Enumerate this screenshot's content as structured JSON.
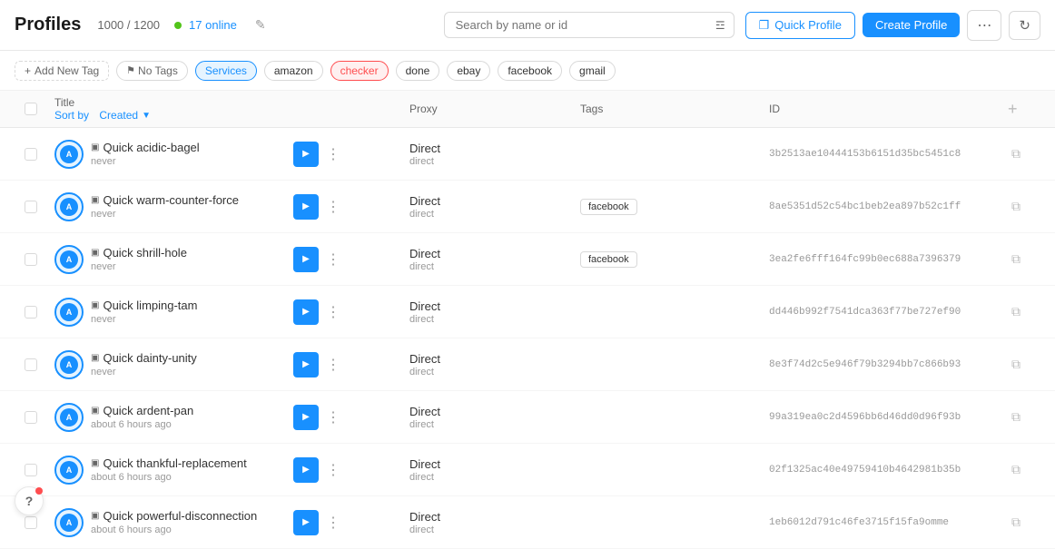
{
  "header": {
    "title": "Profiles",
    "count": "1000 / 1200",
    "online_count": "17 online",
    "search_placeholder": "Search by name or id",
    "quick_profile_label": "Quick Profile",
    "create_profile_label": "Create Profile"
  },
  "tags": [
    {
      "id": "no-tags",
      "label": "No Tags",
      "style": "notag",
      "has_icon": true
    },
    {
      "id": "services",
      "label": "Services",
      "style": "services",
      "has_icon": false
    },
    {
      "id": "amazon",
      "label": "amazon",
      "style": "default",
      "has_icon": false
    },
    {
      "id": "checker",
      "label": "checker",
      "style": "checker",
      "has_icon": false
    },
    {
      "id": "done",
      "label": "done",
      "style": "default",
      "has_icon": false
    },
    {
      "id": "ebay",
      "label": "ebay",
      "style": "default",
      "has_icon": false
    },
    {
      "id": "facebook",
      "label": "facebook",
      "style": "default",
      "has_icon": false
    },
    {
      "id": "gmail",
      "label": "gmail",
      "style": "default",
      "has_icon": false
    }
  ],
  "table": {
    "columns": {
      "title": "Title",
      "sort_by": "Sort by",
      "sort_field": "Created",
      "proxy": "Proxy",
      "tags": "Tags",
      "id": "ID"
    },
    "rows": [
      {
        "name": "Quick acidic-bagel",
        "time": "never",
        "proxy_type": "Direct",
        "proxy_detail": "direct",
        "tags": [],
        "id": "3b2513ae10444153b6151d35bc5451c8"
      },
      {
        "name": "Quick warm-counter-force",
        "time": "never",
        "proxy_type": "Direct",
        "proxy_detail": "direct",
        "tags": [
          "facebook"
        ],
        "id": "8ae5351d52c54bc1beb2ea897b52c1ff"
      },
      {
        "name": "Quick shrill-hole",
        "time": "never",
        "proxy_type": "Direct",
        "proxy_detail": "direct",
        "tags": [
          "facebook"
        ],
        "id": "3ea2fe6fff164fc99b0ec688a7396379"
      },
      {
        "name": "Quick limping-tam",
        "time": "never",
        "proxy_type": "Direct",
        "proxy_detail": "direct",
        "tags": [],
        "id": "dd446b992f7541dca363f77be727ef90"
      },
      {
        "name": "Quick dainty-unity",
        "time": "never",
        "proxy_type": "Direct",
        "proxy_detail": "direct",
        "tags": [],
        "id": "8e3f74d2c5e946f79b3294bb7c866b93"
      },
      {
        "name": "Quick ardent-pan",
        "time": "about 6 hours ago",
        "proxy_type": "Direct",
        "proxy_detail": "direct",
        "tags": [],
        "id": "99a319ea0c2d4596bb6d46dd0d96f93b"
      },
      {
        "name": "Quick thankful-replacement",
        "time": "about 6 hours ago",
        "proxy_type": "Direct",
        "proxy_detail": "direct",
        "tags": [],
        "id": "02f1325ac40e49759410b4642981b35b"
      },
      {
        "name": "Quick powerful-disconnection",
        "time": "about 6 hours ago",
        "proxy_type": "Direct",
        "proxy_detail": "direct",
        "tags": [],
        "id": "1eb6012d791c46fe3715f15fa9omme"
      }
    ]
  },
  "help_button_label": "?",
  "add_tag_label": "+ Add New Tag"
}
